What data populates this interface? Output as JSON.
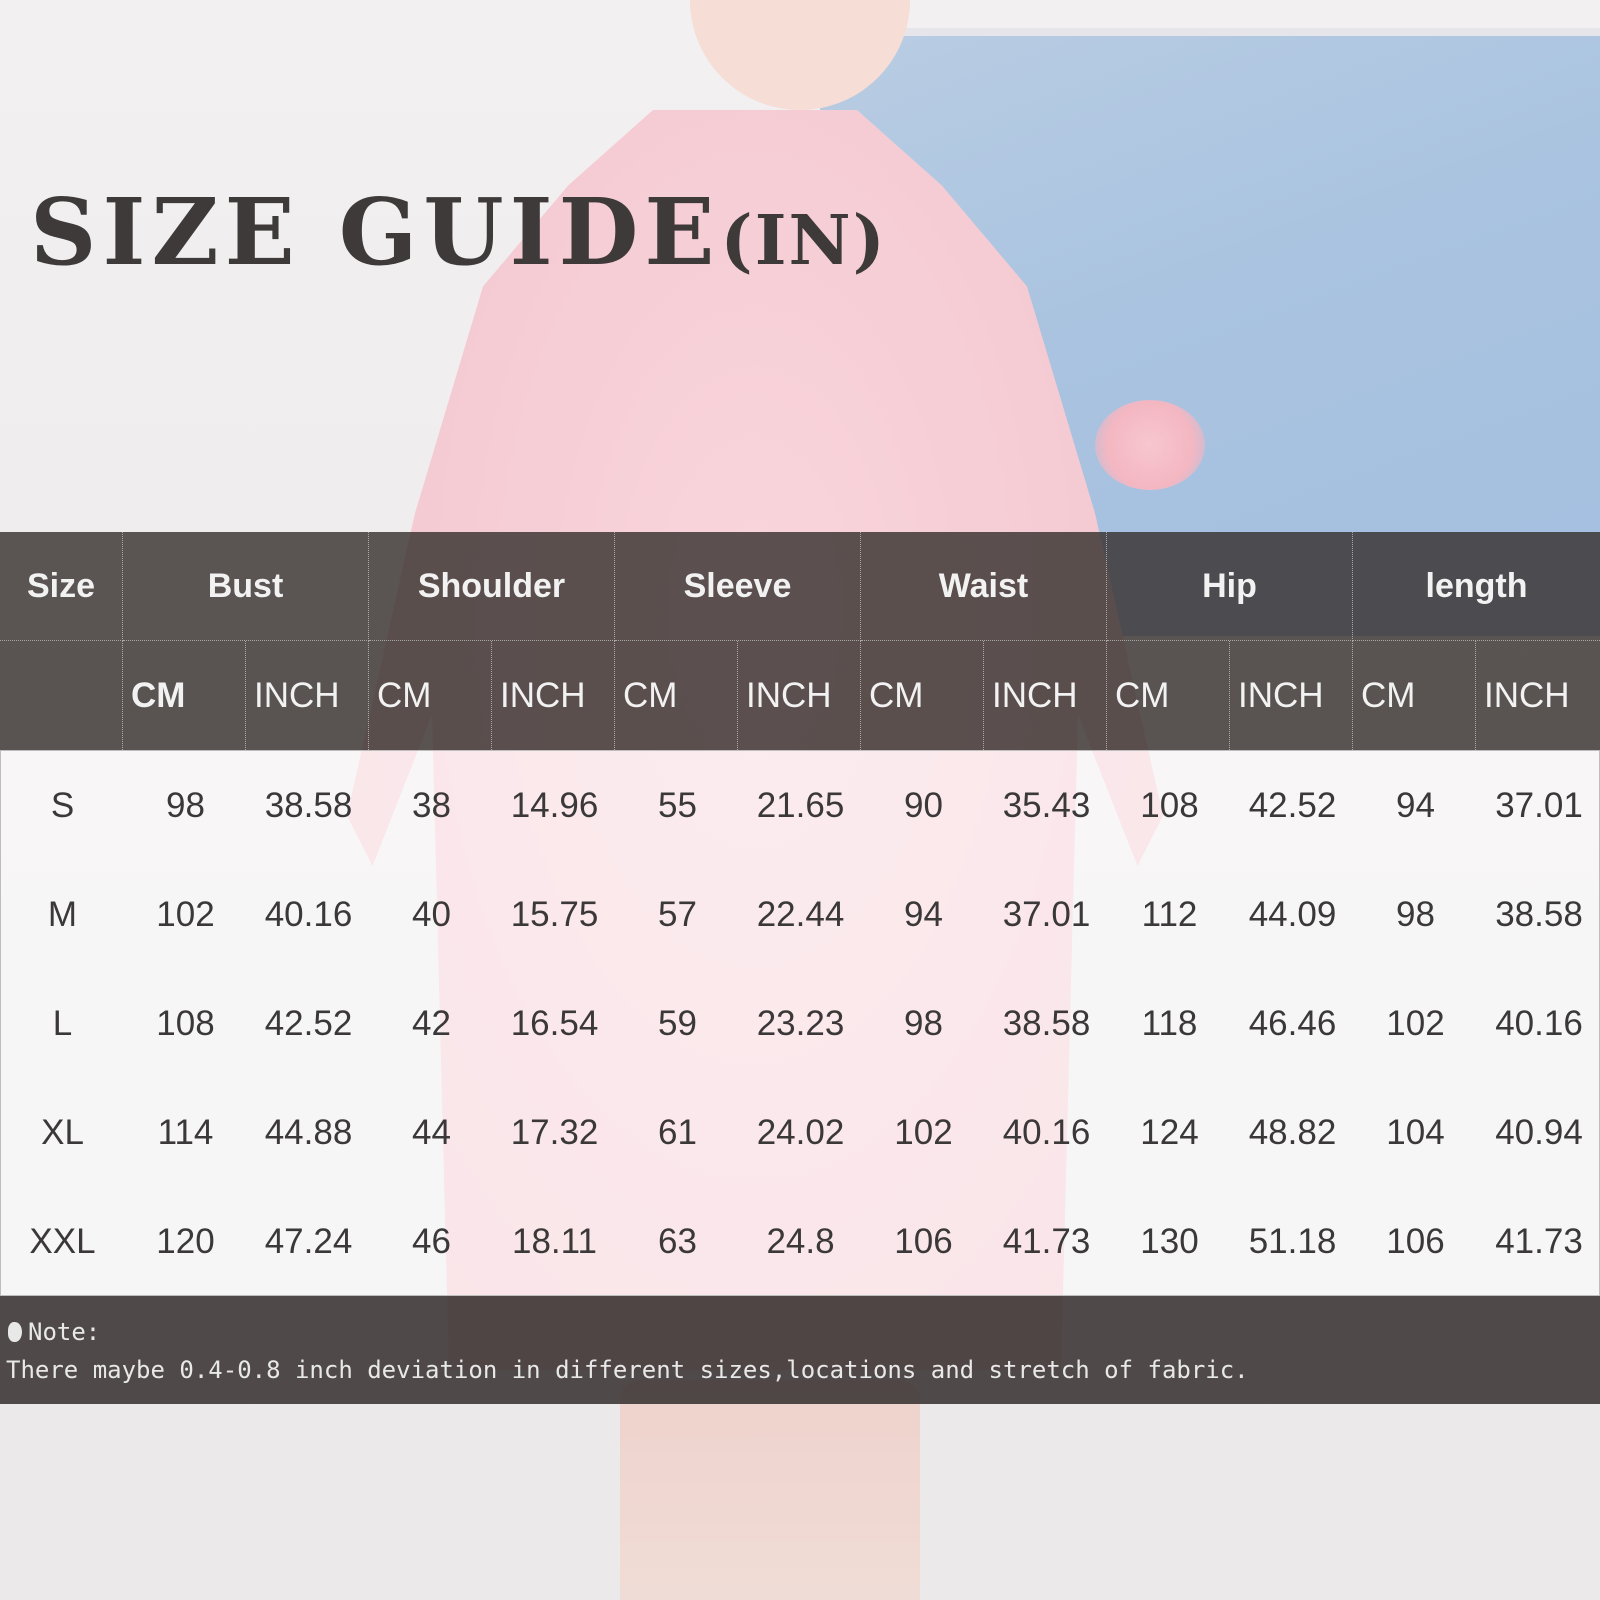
{
  "title": {
    "main": "SIZE GUIDE",
    "suffix": "(IN)"
  },
  "table": {
    "size_header": "Size",
    "groups": [
      "Bust",
      "Shoulder",
      "Sleeve",
      "Waist",
      "Hip",
      "length"
    ],
    "units": [
      "CM",
      "INCH",
      "CM",
      "INCH",
      "CM",
      "INCH",
      "CM",
      "INCH",
      "CM",
      "INCH",
      "CM",
      "INCH"
    ],
    "rows": [
      [
        "S",
        "98",
        "38.58",
        "38",
        "14.96",
        "55",
        "21.65",
        "90",
        "35.43",
        "108",
        "42.52",
        "94",
        "37.01"
      ],
      [
        "M",
        "102",
        "40.16",
        "40",
        "15.75",
        "57",
        "22.44",
        "94",
        "37.01",
        "112",
        "44.09",
        "98",
        "38.58"
      ],
      [
        "L",
        "108",
        "42.52",
        "42",
        "16.54",
        "59",
        "23.23",
        "98",
        "38.58",
        "118",
        "46.46",
        "102",
        "40.16"
      ],
      [
        "XL",
        "114",
        "44.88",
        "44",
        "17.32",
        "61",
        "24.02",
        "102",
        "40.16",
        "124",
        "48.82",
        "104",
        "40.94"
      ],
      [
        "XXL",
        "120",
        "47.24",
        "46",
        "18.11",
        "63",
        "24.8",
        "106",
        "41.73",
        "130",
        "51.18",
        "106",
        "41.73"
      ]
    ]
  },
  "note": {
    "label": "Note:",
    "text": "There maybe 0.4-0.8 inch deviation in different sizes,locations and stretch of fabric."
  }
}
